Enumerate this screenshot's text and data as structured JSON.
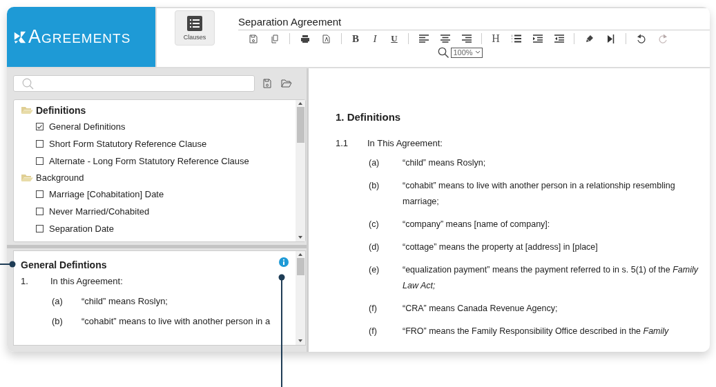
{
  "logo": {
    "text": "AGREEMENTS"
  },
  "clauses_button": {
    "label": "Clauses"
  },
  "document_title": "Separation Agreement",
  "toolbar": {
    "format_buttons": [
      "B",
      "I",
      "U"
    ],
    "heading_button": "H",
    "history": [
      {
        "kind": "undo",
        "disabled": false
      },
      {
        "kind": "redo",
        "disabled": true
      }
    ],
    "zoom": "100%"
  },
  "clause_tree": [
    {
      "label": "Definitions",
      "selected": true,
      "children": [
        {
          "label": "General Definitions",
          "checked": true
        },
        {
          "label": "Short Form Statutory Reference Clause",
          "checked": false
        },
        {
          "label": "Alternate - Long Form Statutory Reference Clause",
          "checked": false
        }
      ]
    },
    {
      "label": "Background",
      "selected": false,
      "children": [
        {
          "label": "Marriage [Cohabitation] Date",
          "checked": false
        },
        {
          "label": "Never Married/Cohabited",
          "checked": false
        },
        {
          "label": "Separation Date",
          "checked": false
        }
      ]
    }
  ],
  "preview": {
    "title": "General Defintions",
    "number": "1.",
    "intro": "In this Agreement:",
    "items": [
      {
        "label": "(a)",
        "text": "“child” means Roslyn;"
      },
      {
        "label": "(b)",
        "text": "“cohabit” means to live with another person in a"
      }
    ]
  },
  "document": {
    "heading": "1. Definitions",
    "number": "1.1",
    "intro": "In This Agreement:",
    "items": [
      {
        "label": "(a)",
        "text": "“child” means Roslyn;"
      },
      {
        "label": "(b)",
        "text": "“cohabit” means to live with another person in a relationship resembling marriage;"
      },
      {
        "label": "(c)",
        "text": "“company” means [name of company]:"
      },
      {
        "label": "(d)",
        "text": "“cottage” means the property at [address] in [place]"
      },
      {
        "label": "(e)",
        "text": "“equalization payment” means the payment referred to in s. 5(1) of the *Family Law Act;*"
      },
      {
        "label": "(f)",
        "text": "“CRA” means Canada Revenue Agency;"
      },
      {
        "label": "(f)",
        "text": "“FRO” means the Family Responsibility Office described in the *Family*"
      }
    ]
  }
}
